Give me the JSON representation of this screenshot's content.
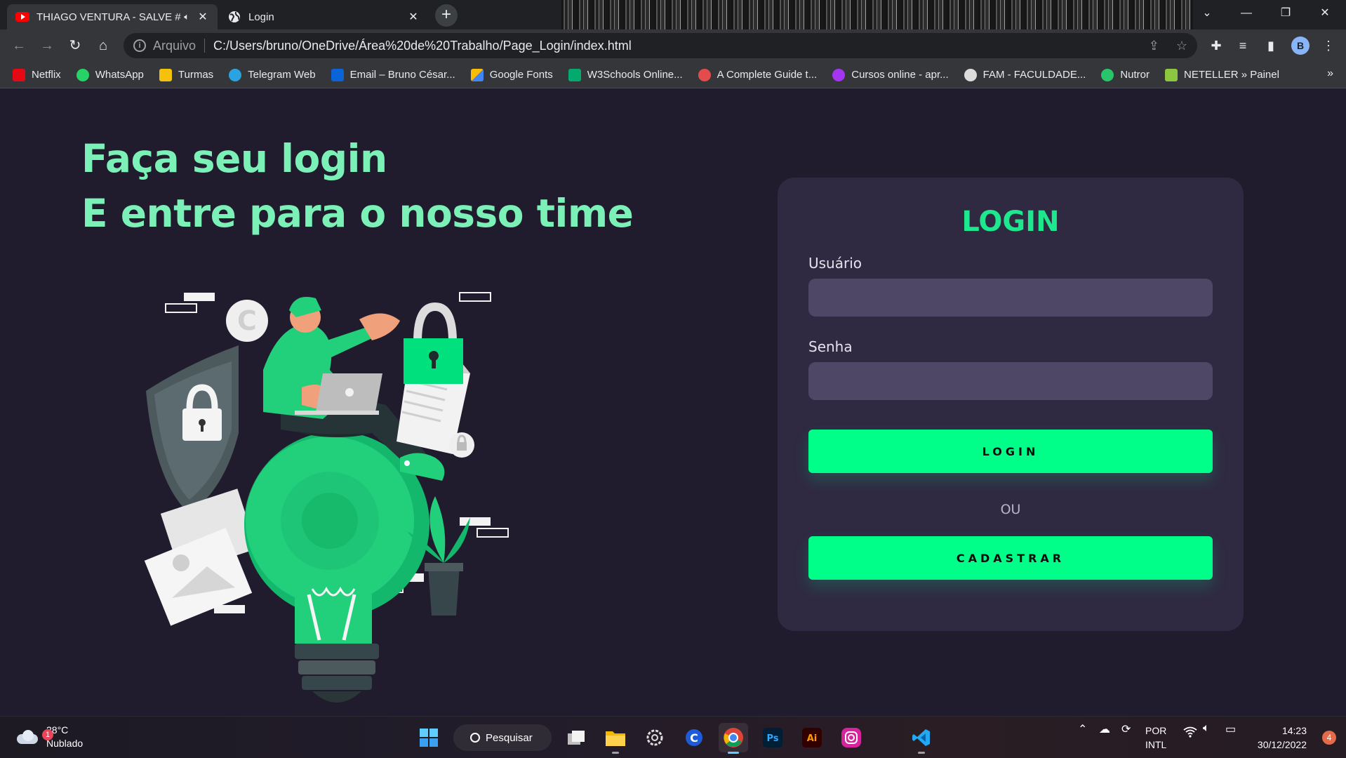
{
  "browser": {
    "tabs": [
      {
        "title": "THIAGO VENTURA - SALVE #",
        "favicon": "youtube-icon",
        "audio": true
      },
      {
        "title": "Login",
        "favicon": "globe-icon"
      }
    ],
    "new_tab": "+",
    "omnibox": {
      "scheme": "Arquivo",
      "url": "C:/Users/bruno/OneDrive/Área%20de%20Trabalho/Page_Login/index.html"
    },
    "profile_initial": "B",
    "bookmarks": [
      {
        "label": "Netflix",
        "color": "#e50914"
      },
      {
        "label": "WhatsApp",
        "color": "#25d366"
      },
      {
        "label": "Turmas",
        "color": "#f4c20d"
      },
      {
        "label": "Telegram Web",
        "color": "#2aa3e0"
      },
      {
        "label": "Email – Bruno César...",
        "color": "#0a64d8"
      },
      {
        "label": "Google Fonts",
        "color": "#4285f4"
      },
      {
        "label": "W3Schools Online...",
        "color": "#04aa6d"
      },
      {
        "label": "A Complete Guide t...",
        "color": "#e34c4c"
      },
      {
        "label": "Cursos online - apr...",
        "color": "#a435f0"
      },
      {
        "label": "FAM - FACULDADE...",
        "color": "#dcdcdc"
      },
      {
        "label": "Nutror",
        "color": "#29c56a"
      },
      {
        "label": "NETELLER » Painel",
        "color": "#8dc63f"
      }
    ],
    "more_bookmarks": "»"
  },
  "page": {
    "headline_line1": "Faça seu login",
    "headline_line2": "E entre para o nosso time",
    "form": {
      "title": "LOGIN",
      "username_label": "Usuário",
      "username_value": "",
      "password_label": "Senha",
      "password_value": "",
      "login_button": "LOGIN",
      "or_text": "OU",
      "register_button": "CADASTRAR"
    },
    "colors": {
      "background": "#201c2e",
      "card": "#2f2942",
      "accent": "#00ff88",
      "headline": "#7bf1b8",
      "input": "#4f4766"
    }
  },
  "taskbar": {
    "weather_temp": "28°C",
    "weather_desc": "Nublado",
    "weather_badge": "1",
    "search_label": "Pesquisar",
    "apps": [
      "windows-start-icon",
      "search",
      "task-view-icon",
      "file-explorer-icon",
      "settings-icon",
      "copilot-icon",
      "chrome-icon",
      "photoshop-icon",
      "illustrator-icon",
      "instagram-icon",
      "vscode-icon"
    ],
    "language_line1": "POR",
    "language_line2": "INTL",
    "time": "14:23",
    "date": "30/12/2022",
    "notifications": "4"
  }
}
